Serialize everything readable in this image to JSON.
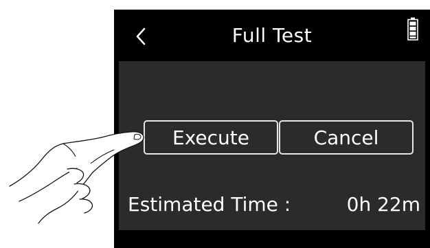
{
  "header": {
    "title": "Full Test",
    "back_icon": "chevron-left-icon",
    "battery_icon": "battery-full-icon"
  },
  "dialog": {
    "execute_label": "Execute",
    "cancel_label": "Cancel"
  },
  "estimate": {
    "label": "Estimated Time :",
    "value": "0h 22m"
  },
  "colors": {
    "screen_bg": "#000000",
    "panel_bg": "#2b2b2b",
    "text": "#ffffff",
    "button_border": "#e5e5e5"
  }
}
